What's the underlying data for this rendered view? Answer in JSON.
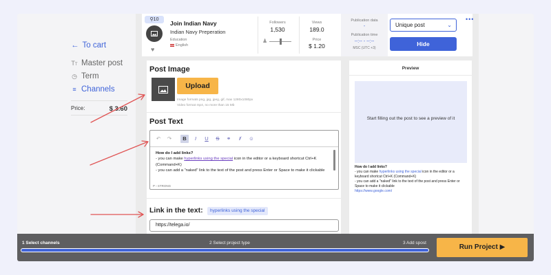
{
  "nav": {
    "back_label": "To cart",
    "items": [
      {
        "label": "Master post",
        "icon": "text-icon"
      },
      {
        "label": "Term",
        "icon": "clock-icon"
      },
      {
        "label": "Channels",
        "icon": "list-icon"
      }
    ],
    "price_label": "Price:",
    "price_value": "$ 3.60"
  },
  "channel": {
    "badge": "10",
    "title": "Join Indian Navy",
    "subtitle": "Indian Navy Preperation",
    "education_label": "Education",
    "language": "English",
    "followers_label": "Followers",
    "followers_value": "1,530",
    "views_label": "Views",
    "views_value": "189.0",
    "price_label": "Price",
    "price_value": "$ 1.20",
    "publication_date_label": "Publication data",
    "publication_date_value": "-",
    "publication_time_label": "Publication time",
    "publication_time_value": "--:-- - --:--",
    "timezone": "MSC (UTC +3)",
    "post_type": "Unique post",
    "hide_label": "Hide",
    "more_label": "•••"
  },
  "post_image": {
    "title": "Post Image",
    "upload_label": "Upload",
    "image_formats": "Image formats png, jpg, jpeg, gif, max 1280x1080px",
    "video_formats": "Video format mp4, no more than 15 Mb"
  },
  "post_text": {
    "title": "Post Text",
    "heading": "How do I add links?",
    "line1_prefix": "- you can make ",
    "line1_link": "hyperlinks using the special",
    "line1_suffix": " icon in the editor or a keyboard shortcut Ctrl+K (Command+K)",
    "line2": "- you can add a \"naked\" link to the text of the post and press Enter or Space to make it clickable",
    "status": "P › STRONG"
  },
  "link": {
    "title": "Link in the text:",
    "chip": "hyperlinks using the special",
    "value": "https://telega.io/"
  },
  "preview": {
    "title": "Preview",
    "empty_message": "Start filling out the post to see a preview of it",
    "heading": "How do I add links?",
    "line1_prefix": "- you can make ",
    "line1_link": "hyperlinks using the special",
    "line1_suffix": " icon in the editor or a keyboard shortcut Ctrl+K (Command+K)",
    "line2": "- you can add a \"naked\" link to the text of the post and press Enter or Space to make it clickable",
    "url": "https://www.google.com/"
  },
  "footer": {
    "step1": "1 Select channels",
    "step2": "2 Select project type",
    "step3": "3 Add spost",
    "progress": 1.0,
    "run_label": "Run Project ▶"
  },
  "colors": {
    "accent": "#3f63d9",
    "upload": "#f7b548",
    "annotation_arrows": "#e05555"
  }
}
